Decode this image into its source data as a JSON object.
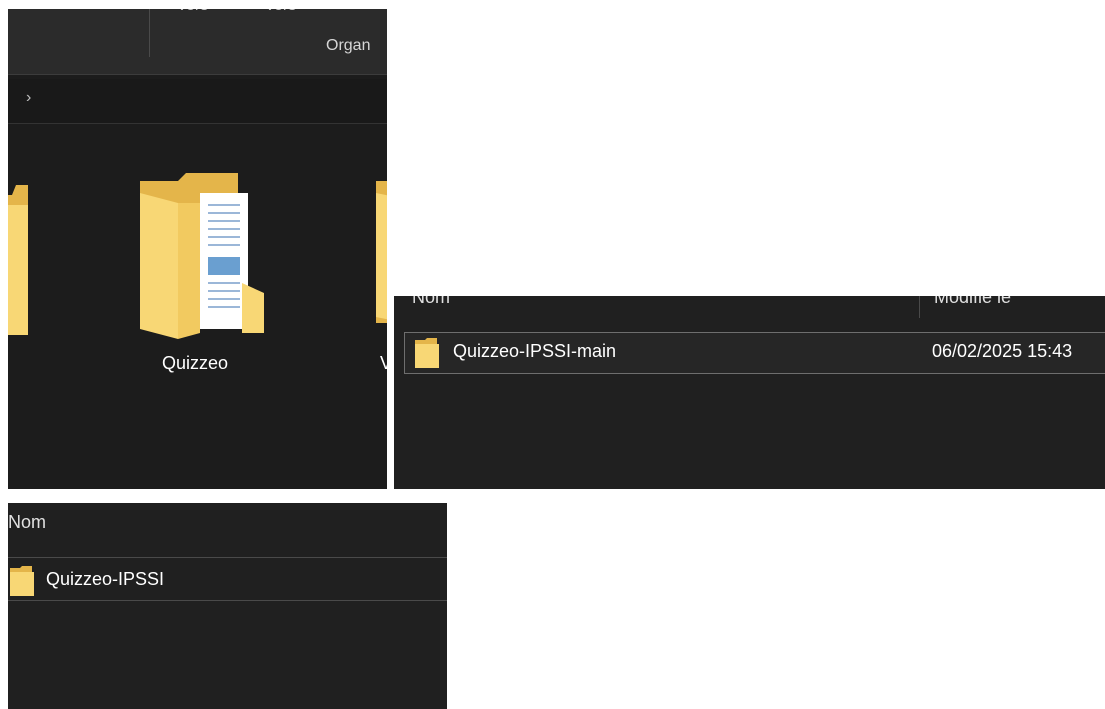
{
  "panel_large_icons": {
    "ribbon": {
      "cut_labels": [
        "vers",
        "vers"
      ],
      "group_label": "Organ"
    },
    "address_bar": {
      "chevron": "›"
    },
    "items": [
      {
        "label": "",
        "icon": "folder-icon"
      },
      {
        "label": "Quizzeo",
        "icon": "folder-with-documents-icon"
      },
      {
        "label": "V",
        "icon": "folder-icon"
      }
    ]
  },
  "panel_details_main": {
    "columns": [
      "Nom",
      "Modifié le"
    ],
    "rows": [
      {
        "name": "Quizzeo-IPSSI-main",
        "modified": "06/02/2025 15:43",
        "icon": "folder-icon"
      }
    ]
  },
  "panel_details_inner": {
    "columns": [
      "Nom"
    ],
    "rows": [
      {
        "name": "Quizzeo-IPSSI",
        "icon": "folder-icon"
      }
    ]
  },
  "colors": {
    "folder_yellow": "#f8d775",
    "folder_dark": "#e4b54a",
    "background_dark": "#202020"
  }
}
